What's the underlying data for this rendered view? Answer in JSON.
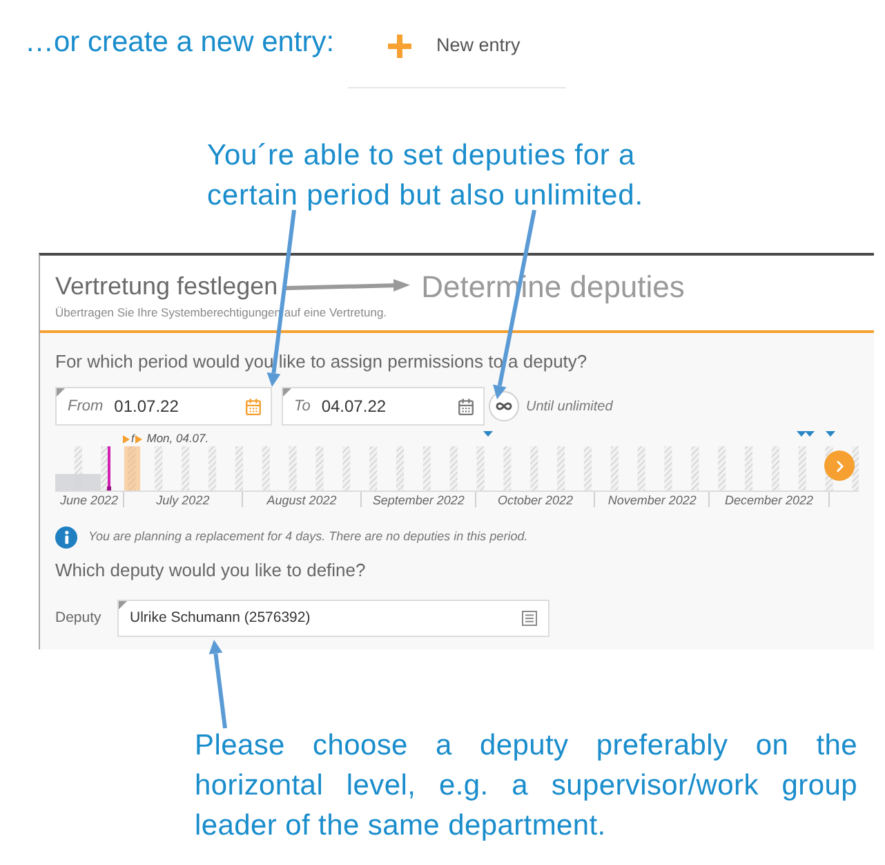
{
  "intro": {
    "text": "…or create a new entry:",
    "new_entry_button": "New entry"
  },
  "callout_top": "You´re able to set deputies for a certain period but also unlimited.",
  "dialog": {
    "title": "Vertretung festlegen",
    "title_translation": "Determine deputies",
    "subtitle": "Übertragen Sie Ihre Systemberechtigungen auf eine Vertretung.",
    "period_question": "For which period would you like to assign permissions to a deputy?",
    "from_field": {
      "label": "From",
      "value": "01.07.22",
      "active": true
    },
    "to_field": {
      "label": "To",
      "value": "04.07.22",
      "active": false
    },
    "unlimited": {
      "label": "Until unlimited",
      "on": false
    },
    "timeline": {
      "marker_symbol": "f",
      "marker_label": "Mon, 04.07.",
      "months": [
        "June 2022",
        "July 2022",
        "August 2022",
        "September 2022",
        "October 2022",
        "November 2022",
        "December 2022"
      ]
    },
    "info": "You are planning a replacement for 4 days. There are no deputies in this period.",
    "deputy_question": "Which deputy would you like to define?",
    "deputy_field": {
      "label": "Deputy",
      "value": "Ulrike Schumann (2576392)"
    }
  },
  "callout_bottom": "Please choose a deputy preferably on the horizontal level, e.g. a supervisor/work group leader of the same department."
}
